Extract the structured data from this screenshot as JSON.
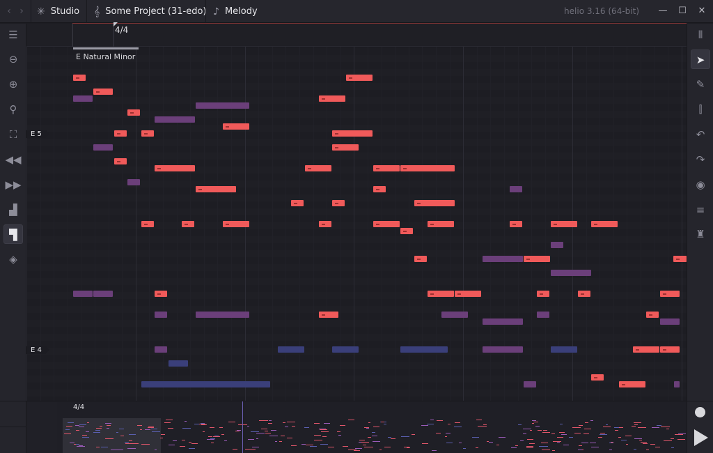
{
  "titlebar": {
    "breadcrumbs": [
      {
        "icon": "studio-icon",
        "label": "Studio"
      },
      {
        "icon": "treble-clef-icon",
        "label": "Some Project (31-edo)"
      },
      {
        "icon": "eighth-note-icon",
        "label": "Melody"
      }
    ],
    "version": "helio 3.16 (64-bit)"
  },
  "ruler": {
    "time_signature": "4/4"
  },
  "key_signature": "E Natural Minor",
  "row_labels": [
    "E 5",
    "E 4"
  ],
  "minimap": {
    "time_signature": "4/4"
  },
  "left_tools": [
    "layout-icon",
    "zoom-out-icon",
    "zoom-in-icon",
    "zoom-tool-icon",
    "zoom-fit-icon",
    "rewind-icon",
    "fast-forward-icon",
    "volume-bars-icon",
    "paint-roller-icon",
    "tag-icon"
  ],
  "right_tools": [
    "toggle-panel-icon",
    "cursor-icon",
    "pen-icon",
    "split-icon",
    "undo-icon",
    "redo-icon",
    "metronome-icon",
    "arpeggiator-icon",
    "tuning-fork-icon"
  ],
  "colors": {
    "note_active": "#f05a5a",
    "note_ghost_purple": "#6b3f7a",
    "note_ghost_blue": "#3a3f7a",
    "accent": "#a33c3c"
  }
}
